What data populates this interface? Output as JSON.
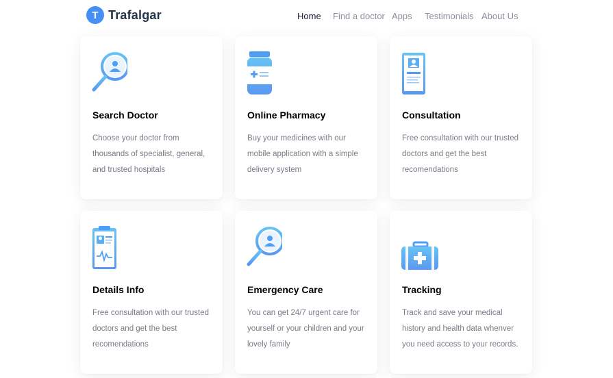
{
  "header": {
    "logo_letter": "T",
    "brand": "Trafalgar",
    "nav": [
      {
        "label": "Home"
      },
      {
        "label": "Find a doctor"
      },
      {
        "label": "Apps"
      },
      {
        "label": "Testimonials"
      },
      {
        "label": "About Us"
      }
    ]
  },
  "services": [
    {
      "title": "Search Doctor",
      "description": "Choose your doctor from thousands of specialist, general, and trusted hospitals",
      "icon": "search-doctor-icon"
    },
    {
      "title": "Online Pharmacy",
      "description": "Buy your medicines with our mobile application with a simple delivery system",
      "icon": "pharmacy-bottle-icon"
    },
    {
      "title": "Consultation",
      "description": "Free consultation with our trusted doctors and get the best recomendations",
      "icon": "consultation-phone-icon"
    },
    {
      "title": "Details Info",
      "description": "Free consultation with our trusted doctors and get the best recomendations",
      "icon": "clipboard-info-icon"
    },
    {
      "title": "Emergency Care",
      "description": "You can get 24/7 urgent care for yourself or your children and your lovely family",
      "icon": "emergency-search-icon"
    },
    {
      "title": "Tracking",
      "description": "Track and save your medical history and health data whenver you need access to your records.",
      "icon": "medical-kit-icon"
    }
  ],
  "colors": {
    "accent": "#458ff6",
    "accent_light": "#5ebdfd",
    "title": "#000000",
    "body_text": "#7d7987"
  }
}
